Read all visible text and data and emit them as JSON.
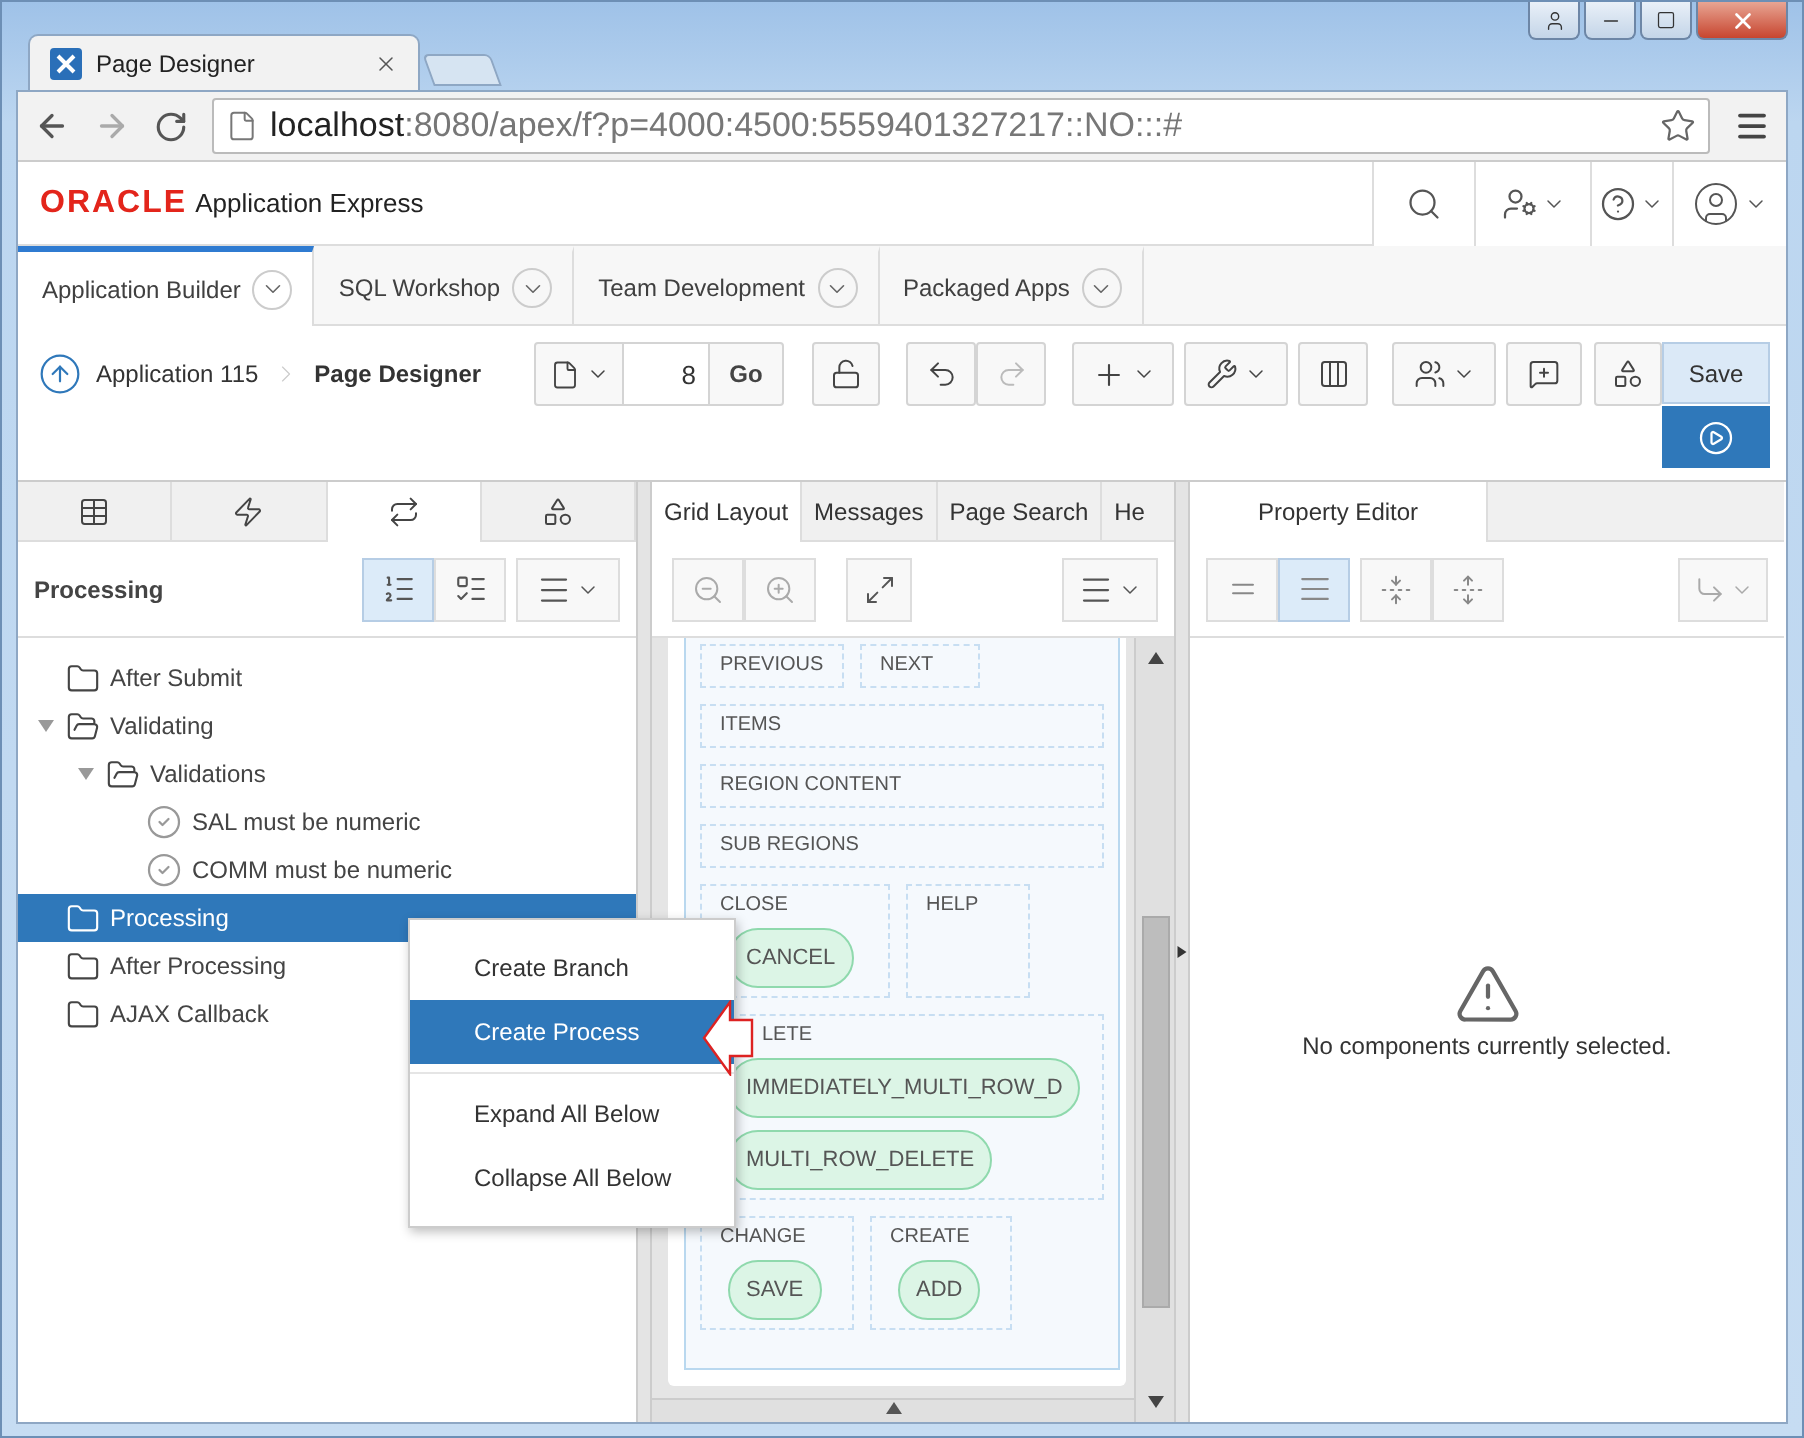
{
  "browser": {
    "tab_title": "Page Designer",
    "url_host": "localhost",
    "url_rest": ":8080/apex/f?p=4000:4500:5559401327217::NO:::#"
  },
  "header": {
    "brand": "ORACLE",
    "product": "Application Express"
  },
  "nav_tabs": [
    {
      "label": "Application Builder",
      "selected": true
    },
    {
      "label": "SQL Workshop",
      "selected": false
    },
    {
      "label": "Team Development",
      "selected": false
    },
    {
      "label": "Packaged Apps",
      "selected": false
    }
  ],
  "toolbar": {
    "breadcrumb": [
      {
        "label": "Application 115",
        "current": false
      },
      {
        "label": "Page Designer",
        "current": true
      }
    ],
    "page_number": "8",
    "go": "Go",
    "save": "Save"
  },
  "left_panel": {
    "tabs": [
      {
        "kind": "rendering",
        "selected": false
      },
      {
        "kind": "dynamic_actions",
        "selected": false
      },
      {
        "kind": "processing",
        "selected": true
      },
      {
        "kind": "shared",
        "selected": false
      }
    ],
    "title": "Processing",
    "views": [
      {
        "kind": "ordered",
        "selected": true
      },
      {
        "kind": "grouped",
        "selected": false
      }
    ],
    "tree": [
      {
        "label": "After Submit",
        "kind": "folder",
        "selected": false
      },
      {
        "label": "Validating",
        "kind": "folder",
        "selected": false,
        "expanded": true,
        "children": [
          {
            "label": "Validations",
            "kind": "folder",
            "selected": false,
            "expanded": true,
            "children": [
              {
                "label": "SAL must be numeric",
                "kind": "validation",
                "selected": false
              },
              {
                "label": "COMM must be numeric",
                "kind": "validation",
                "selected": false
              }
            ]
          }
        ]
      },
      {
        "label": "Processing",
        "kind": "folder",
        "selected": true
      },
      {
        "label": "After Processing",
        "kind": "folder",
        "selected": false
      },
      {
        "label": "AJAX Callback",
        "kind": "folder",
        "selected": false
      }
    ]
  },
  "center_panel": {
    "tabs": [
      {
        "label": "Grid Layout",
        "selected": true
      },
      {
        "label": "Messages",
        "selected": false
      },
      {
        "label": "Page Search",
        "selected": false
      },
      {
        "label": "He",
        "selected": false
      }
    ],
    "rows": [
      [
        {
          "label": "PREVIOUS"
        },
        {
          "label": "NEXT"
        }
      ],
      [
        {
          "label": "ITEMS"
        }
      ],
      [
        {
          "label": "REGION CONTENT"
        }
      ],
      [
        {
          "label": "SUB REGIONS"
        }
      ],
      [
        {
          "label": "CLOSE",
          "buttons": [
            "CANCEL"
          ]
        },
        {
          "label": "HELP"
        }
      ],
      [
        {
          "label": "LETE",
          "buttons": [
            "IMMEDIATELY_MULTI_ROW_D",
            "MULTI_ROW_DELETE"
          ]
        }
      ],
      [
        {
          "label": "CHANGE",
          "buttons": [
            "SAVE"
          ]
        },
        {
          "label": "CREATE",
          "buttons": [
            "ADD"
          ]
        }
      ]
    ]
  },
  "right_panel": {
    "tabs": [
      {
        "label": "Property Editor",
        "selected": true
      }
    ],
    "views": [
      {
        "kind": "compact",
        "selected": false
      },
      {
        "kind": "normal",
        "selected": true
      }
    ],
    "message": "No components currently selected."
  },
  "context_menu": {
    "groups": [
      [
        {
          "label": "Create Branch",
          "selected": false
        },
        {
          "label": "Create Process",
          "selected": true
        }
      ],
      [
        {
          "label": "Expand All Below",
          "selected": false
        },
        {
          "label": "Collapse All Below",
          "selected": false
        }
      ]
    ]
  }
}
